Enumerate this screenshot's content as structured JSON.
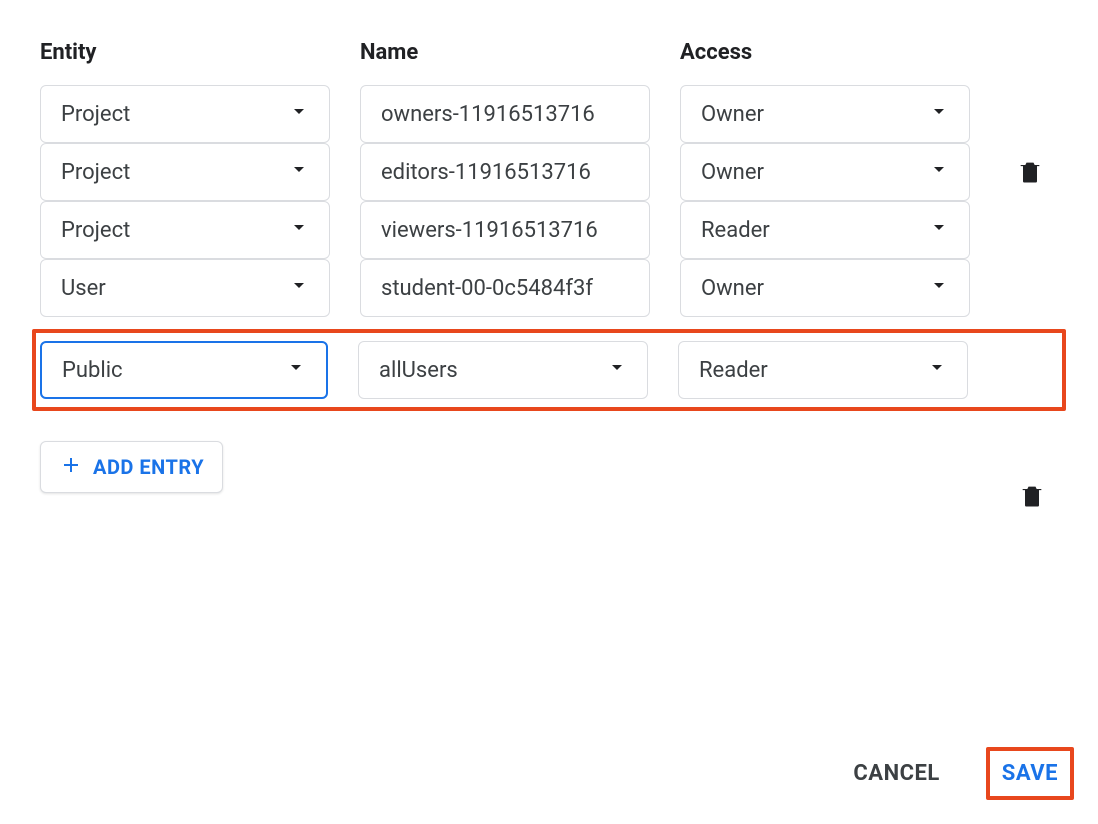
{
  "headers": {
    "entity": "Entity",
    "name": "Name",
    "access": "Access"
  },
  "rows": [
    {
      "entity": "Project",
      "name": "owners-11916513716",
      "access": "Owner",
      "deletable": false,
      "name_is_dropdown": false
    },
    {
      "entity": "Project",
      "name": "editors-11916513716",
      "access": "Owner",
      "deletable": true,
      "name_is_dropdown": false
    },
    {
      "entity": "Project",
      "name": "viewers-11916513716",
      "access": "Reader",
      "deletable": false,
      "name_is_dropdown": false
    },
    {
      "entity": "User",
      "name": "student-00-0c5484f3f",
      "access": "Owner",
      "deletable": false,
      "name_is_dropdown": false
    }
  ],
  "highlighted_row": {
    "entity": "Public",
    "name": "allUsers",
    "access": "Reader",
    "deletable": true,
    "entity_focused": true,
    "name_is_dropdown": true
  },
  "buttons": {
    "add_entry": "ADD ENTRY",
    "cancel": "CANCEL",
    "save": "SAVE"
  }
}
